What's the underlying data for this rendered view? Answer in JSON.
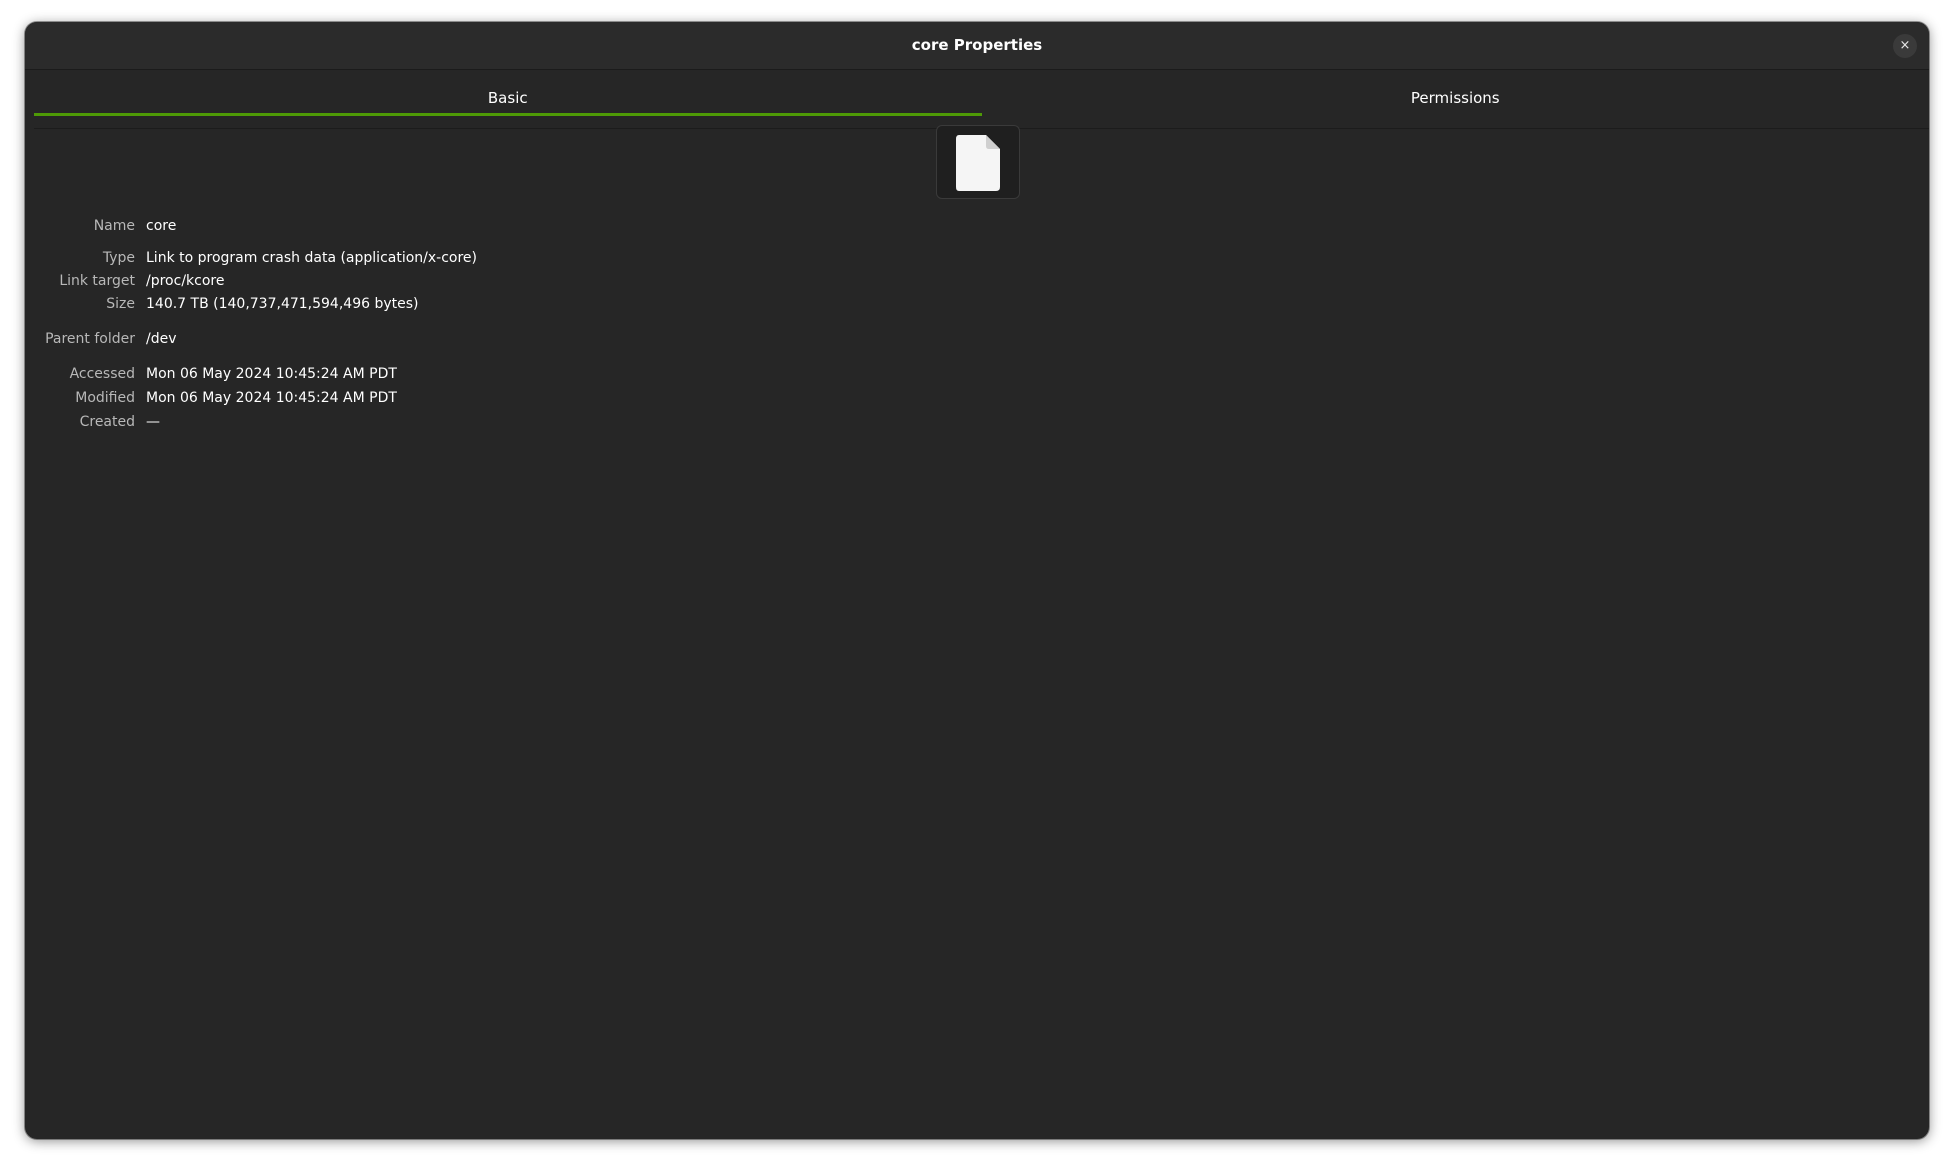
{
  "window": {
    "title": "core Properties",
    "close_icon": "×"
  },
  "tabs": [
    {
      "label": "Basic",
      "active": true
    },
    {
      "label": "Permissions",
      "active": false
    }
  ],
  "icon": {
    "name": "text-file-icon"
  },
  "properties": {
    "name": {
      "label": "Name",
      "value": "core"
    },
    "type": {
      "label": "Type",
      "value": "Link to program crash data (application/x-core)"
    },
    "link_target": {
      "label": "Link target",
      "value": "/proc/kcore"
    },
    "size": {
      "label": "Size",
      "value": "140.7 TB (140,737,471,594,496 bytes)"
    },
    "parent_folder": {
      "label": "Parent folder",
      "value": "/dev"
    },
    "accessed": {
      "label": "Accessed",
      "value": "Mon 06 May 2024 10:45:24 AM PDT"
    },
    "modified": {
      "label": "Modified",
      "value": "Mon 06 May 2024 10:45:24 AM PDT"
    },
    "created": {
      "label": "Created",
      "value": "—"
    }
  },
  "colors": {
    "accent": "#4e9a06",
    "window_bg": "#262626",
    "headerbar_bg": "#2b2b2b"
  }
}
